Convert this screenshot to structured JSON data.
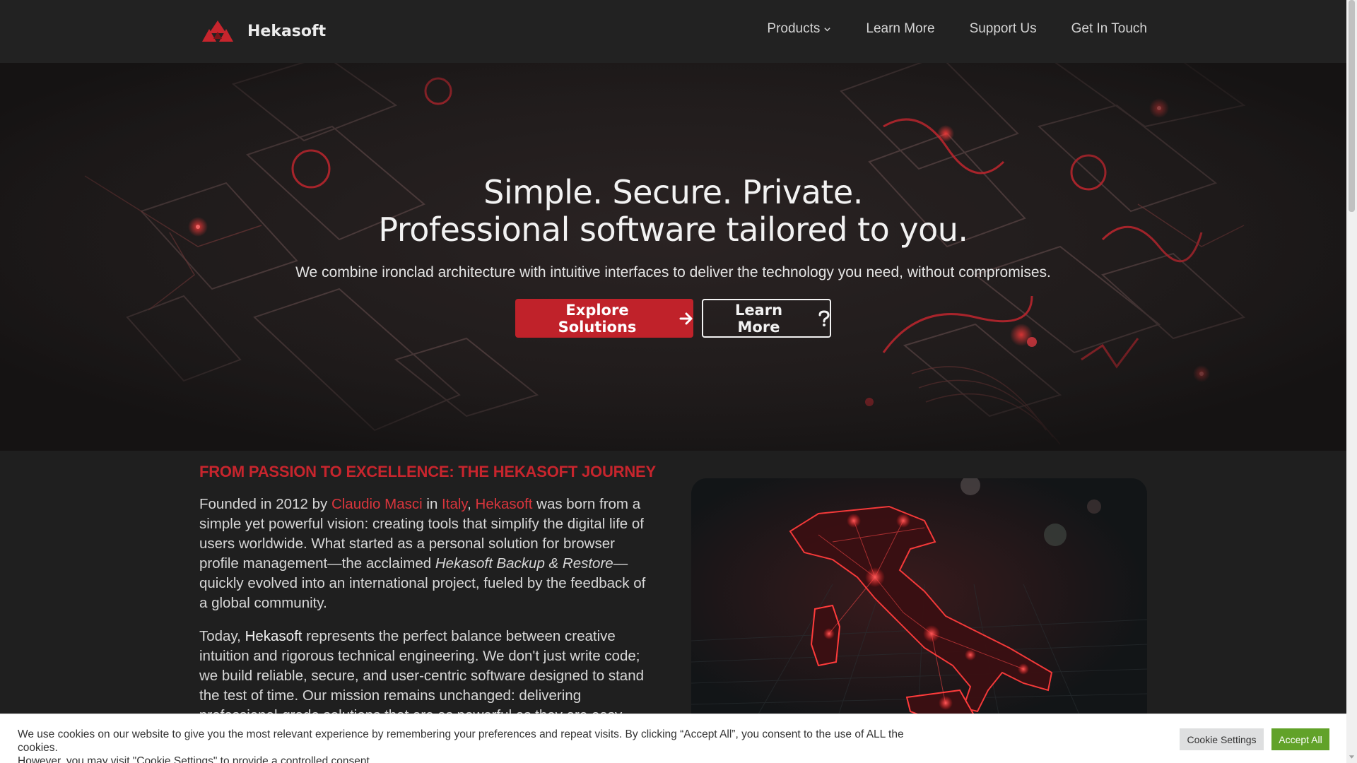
{
  "header": {
    "brand_name": "Hekasoft",
    "nav": [
      {
        "label": "Products"
      },
      {
        "label": "Learn More"
      },
      {
        "label": "Support Us"
      },
      {
        "label": "Get In Touch"
      }
    ]
  },
  "hero": {
    "title_line1": "Simple. Secure. Private.",
    "title_line2": "Professional software tailored to you.",
    "subtitle": "We combine ironclad architecture with intuitive interfaces to deliver the technology you need, without compromises.",
    "primary_button": "Explore Solutions",
    "secondary_button": "Learn More"
  },
  "about": {
    "heading": "FROM PASSION TO EXCELLENCE: THE HEKASOFT JOURNEY",
    "p1_a": "Founded in 2012 by ",
    "p1_founder": "Claudio Masci",
    "p1_b": " in ",
    "p1_country": "Italy",
    "p1_c": ", ",
    "p1_company": "Hekasoft",
    "p1_d": " was born from a simple yet powerful vision: creating tools that simplify the digital life of users worldwide. What started as a personal solution for browser profile management—the acclaimed ",
    "p1_product": "Hekasoft Backup & Restore",
    "p1_e": "—quickly evolved into an international project, fueled by the feedback of a global community.",
    "p2_a": "Today, ",
    "p2_company": "Hekasoft",
    "p2_b": " represents the perfect balance between creative intuition and rigorous technical engineering. We don't just write code; we build reliable, secure, and user-centric software designed to stand the test of time. Our mission remains unchanged: delivering professional-grade solutions that are as powerful as they are easy"
  },
  "cookie": {
    "line1": "We use cookies on our website to give you the most relevant experience by remembering your preferences and repeat visits. By clicking “Accept All”, you consent to the use of ALL the cookies.",
    "line2": "However, you may visit \"Cookie Settings\" to provide a controlled consent.",
    "settings_button": "Cookie Settings",
    "accept_button": "Accept All"
  },
  "colors": {
    "accent": "#c0222a",
    "header_bg": "#222222",
    "accept_green": "#61a229"
  }
}
